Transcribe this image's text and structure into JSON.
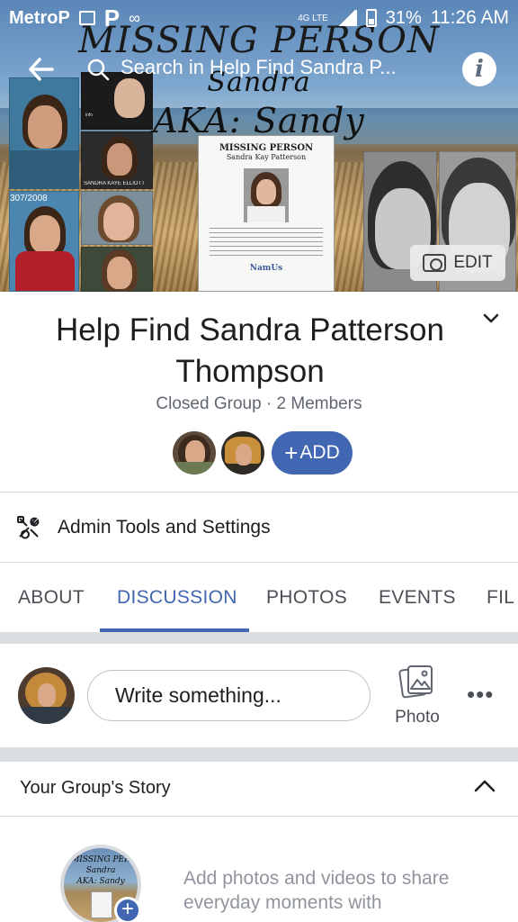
{
  "status_bar": {
    "carrier": "MetroP",
    "network": "4G LTE",
    "battery": "31%",
    "time": "11:26 AM"
  },
  "cover": {
    "title_line1": "MISSING PERSON",
    "title_line2": "Sandra",
    "title_line3": "AKA: Sandy",
    "poster_heading": "MISSING PERSON",
    "poster_name": "Sandra Kay Patterson",
    "poster_logo": "NamUs",
    "photo_caption_1": "307/2008",
    "photo_caption_2": "SANDRA KAYE ELLIOTT",
    "edit_label": "EDIT"
  },
  "topbar": {
    "search_placeholder": "Search in Help Find Sandra P..."
  },
  "group": {
    "name": "Help Find Sandra Patterson Thompson",
    "meta": "Closed Group · 2 Members",
    "add_label": "ADD"
  },
  "admin": {
    "label": "Admin Tools and Settings"
  },
  "tabs": [
    {
      "label": "ABOUT"
    },
    {
      "label": "DISCUSSION"
    },
    {
      "label": "PHOTOS"
    },
    {
      "label": "EVENTS"
    },
    {
      "label": "FIL"
    }
  ],
  "composer": {
    "placeholder": "Write something...",
    "photo_label": "Photo"
  },
  "story": {
    "title": "Your Group's Story",
    "thumb_line1": "MISSING PER",
    "thumb_line2": "Sandra",
    "thumb_line3": "AKA: Sandy",
    "prompt": "Add photos and videos to share everyday moments with"
  },
  "colors": {
    "accent": "#4267b2",
    "text": "#1c1e21",
    "muted": "#606770",
    "band": "#dadde1"
  }
}
